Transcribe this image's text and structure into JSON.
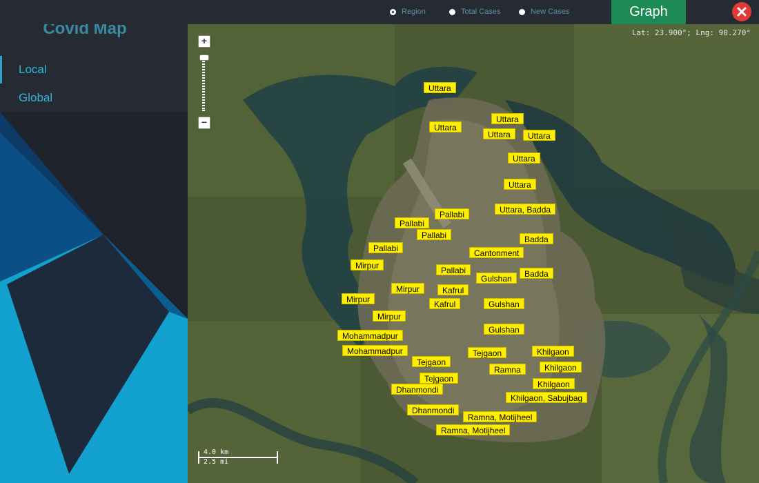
{
  "app": {
    "title": "Covid Map"
  },
  "nav": [
    {
      "label": "Local",
      "active": true
    },
    {
      "label": "Global",
      "active": false
    }
  ],
  "modes": [
    {
      "label": "Region",
      "selected": true
    },
    {
      "label": "Total Cases",
      "selected": false
    },
    {
      "label": "New Cases",
      "selected": false
    }
  ],
  "graph_button": {
    "label": "Graph"
  },
  "map": {
    "coords": "Lat: 23.900°; Lng: 90.270°",
    "scale_km": "4.0 km",
    "scale_mi": "2.5 mi",
    "labels": [
      "Uttara",
      "Uttara",
      "Uttara",
      "Uttara",
      "Uttara",
      "Uttara",
      "Uttara",
      "Uttara, Badda",
      "Pallabi",
      "Pallabi",
      "Pallabi",
      "Pallabi",
      "Pallabi",
      "Badda",
      "Cantonment",
      "Mirpur",
      "Badda",
      "Gulshan",
      "Mirpur",
      "Kafrul",
      "Mirpur",
      "Kafrul",
      "Gulshan",
      "Mirpur",
      "Gulshan",
      "Mohammadpur",
      "Mohammadpur",
      "Tejgaon",
      "Khilgaon",
      "Tejgaon",
      "Khilgaon",
      "Ramna",
      "Tejgaon",
      "Khilgaon",
      "Dhanmondi",
      "Khilgaon, Sabujbag",
      "Dhanmondi",
      "Ramna, Motijheel",
      "Ramna, Motijheel"
    ]
  },
  "colors": {
    "accent": "#2fb8d6",
    "graph": "#1b8a55",
    "close": "#e23838",
    "label_bg": "#ffee00"
  }
}
